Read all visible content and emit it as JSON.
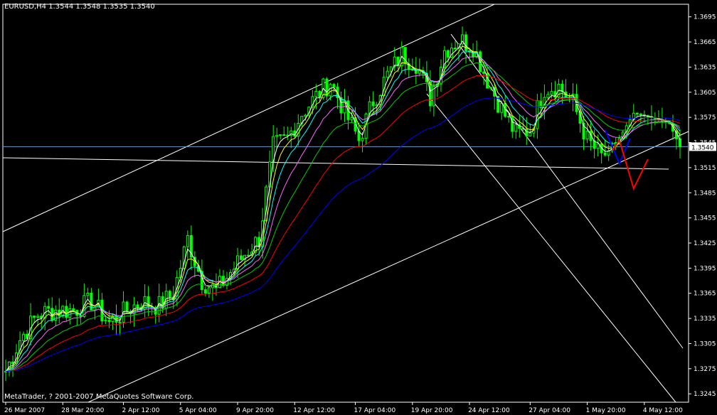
{
  "header": {
    "text": "EURUSD,H4  1.3544 1.3548 1.3535 1.3540"
  },
  "footer": {
    "copyright": "MetaTrader, ? 2001-2007 MetaQuotes Software Corp."
  },
  "colors": {
    "background": "#000000",
    "axis": "#ffffff",
    "candle": "#00ff00",
    "ma_white": "#ffffff",
    "ma_yellow": "#ffff00",
    "ma_cyan": "#00ffff",
    "ma_magenta": "#ff66ff",
    "ma_green": "#00cc00",
    "ma_red": "#ff0000",
    "ma_blue": "#0000ff",
    "price_line": "#6699cc",
    "forecast_blue": "#0000ff",
    "forecast_red": "#ff0000",
    "trendline": "#ffffff"
  },
  "chart_data": {
    "type": "candlestick",
    "symbol": "EURUSD",
    "timeframe": "H4",
    "last_quote": {
      "open": 1.3544,
      "high": 1.3548,
      "low": 1.3535,
      "close": 1.354
    },
    "price_label": "1.3540",
    "y_ticks": [
      "1.3695",
      "1.3665",
      "1.3635",
      "1.3605",
      "1.3575",
      "1.3545",
      "1.3515",
      "1.3485",
      "1.3455",
      "1.3425",
      "1.3395",
      "1.3365",
      "1.3335",
      "1.3305",
      "1.3275",
      "1.3245"
    ],
    "y_range": [
      1.3245,
      1.3695
    ],
    "x_ticks": [
      "26 Mar 2007",
      "28 Mar 20:00",
      "2 Apr 12:00",
      "5 Apr 04:00",
      "9 Apr 20:00",
      "12 Apr 12:00",
      "17 Apr 04:00",
      "19 Apr 20:00",
      "24 Apr 12:00",
      "27 Apr 04:00",
      "1 May 20:00",
      "4 May 12:00"
    ],
    "bar_count": 190,
    "close_anchors": [
      [
        0,
        1.3272
      ],
      [
        6,
        1.332
      ],
      [
        10,
        1.3338
      ],
      [
        18,
        1.335
      ],
      [
        26,
        1.334
      ],
      [
        32,
        1.336
      ],
      [
        38,
        1.3352
      ],
      [
        46,
        1.3345
      ],
      [
        50,
        1.336
      ],
      [
        54,
        1.334
      ],
      [
        60,
        1.3368
      ],
      [
        66,
        1.3378
      ],
      [
        72,
        1.3368
      ],
      [
        76,
        1.3382
      ],
      [
        80,
        1.3372
      ],
      [
        84,
        1.3378
      ],
      [
        88,
        1.3395
      ],
      [
        92,
        1.341
      ],
      [
        96,
        1.3428
      ],
      [
        102,
        1.3385
      ],
      [
        106,
        1.3375
      ],
      [
        112,
        1.3365
      ],
      [
        118,
        1.339
      ],
      [
        124,
        1.3395
      ],
      [
        130,
        1.3375
      ],
      [
        134,
        1.34
      ],
      [
        140,
        1.343
      ],
      [
        146,
        1.345
      ],
      [
        152,
        1.3445
      ],
      [
        158,
        1.346
      ],
      [
        162,
        1.3478
      ],
      [
        166,
        1.352
      ],
      [
        172,
        1.355
      ],
      [
        176,
        1.358
      ],
      [
        180,
        1.3576
      ],
      [
        186,
        1.3568
      ],
      [
        189,
        1.354
      ]
    ],
    "wave_x_anchors": [
      [
        0,
        1.3272
      ],
      [
        4,
        1.331
      ],
      [
        9,
        1.334
      ],
      [
        14,
        1.3345
      ],
      [
        19,
        1.3345
      ],
      [
        24,
        1.3355
      ],
      [
        29,
        1.333
      ],
      [
        34,
        1.3345
      ],
      [
        38,
        1.3355
      ],
      [
        43,
        1.335
      ],
      [
        47,
        1.3365
      ],
      [
        51,
        1.343
      ],
      [
        55,
        1.338
      ],
      [
        59,
        1.3368
      ],
      [
        63,
        1.339
      ],
      [
        67,
        1.3412
      ],
      [
        71,
        1.343
      ],
      [
        75,
        1.354
      ],
      [
        79,
        1.355
      ],
      [
        83,
        1.358
      ],
      [
        87,
        1.36
      ],
      [
        91,
        1.3618
      ],
      [
        95,
        1.3582
      ],
      [
        99,
        1.3548
      ],
      [
        103,
        1.3595
      ],
      [
        107,
        1.3625
      ],
      [
        111,
        1.365
      ],
      [
        115,
        1.364
      ],
      [
        119,
        1.3598
      ],
      [
        123,
        1.3655
      ],
      [
        127,
        1.3668
      ],
      [
        131,
        1.366
      ],
      [
        135,
        1.362
      ],
      [
        139,
        1.3585
      ],
      [
        143,
        1.3555
      ],
      [
        147,
        1.356
      ],
      [
        151,
        1.361
      ],
      [
        155,
        1.3612
      ],
      [
        159,
        1.3592
      ],
      [
        163,
        1.3548
      ],
      [
        167,
        1.3528
      ]
    ],
    "forecast": {
      "blue": [
        [
          168,
          1.356
        ],
        [
          172,
          1.352
        ],
        [
          175,
          1.355
        ]
      ],
      "red": [
        [
          170,
          1.3535
        ],
        [
          172,
          1.3548
        ],
        [
          176,
          1.349
        ],
        [
          180,
          1.3525
        ]
      ]
    }
  }
}
